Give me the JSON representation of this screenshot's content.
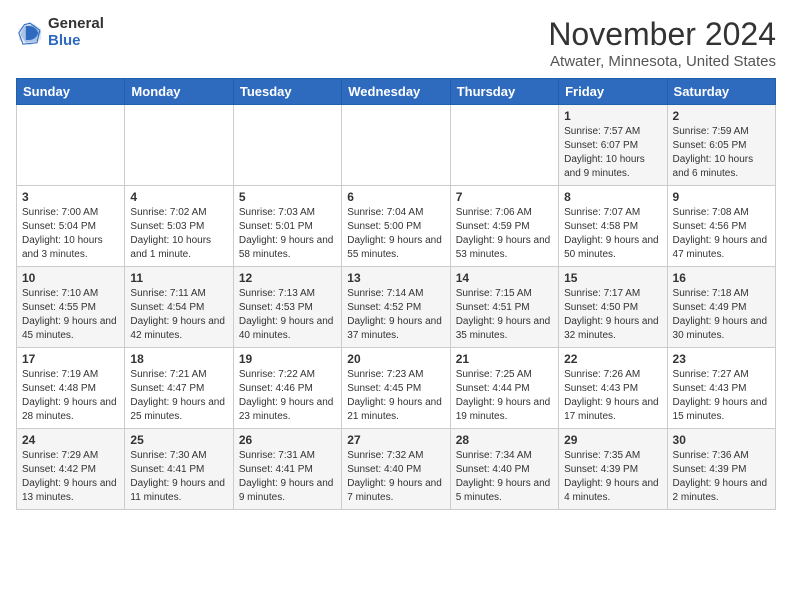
{
  "header": {
    "logo_general": "General",
    "logo_blue": "Blue",
    "month_title": "November 2024",
    "location": "Atwater, Minnesota, United States"
  },
  "days_of_week": [
    "Sunday",
    "Monday",
    "Tuesday",
    "Wednesday",
    "Thursday",
    "Friday",
    "Saturday"
  ],
  "weeks": [
    [
      {
        "num": "",
        "info": ""
      },
      {
        "num": "",
        "info": ""
      },
      {
        "num": "",
        "info": ""
      },
      {
        "num": "",
        "info": ""
      },
      {
        "num": "",
        "info": ""
      },
      {
        "num": "1",
        "info": "Sunrise: 7:57 AM\nSunset: 6:07 PM\nDaylight: 10 hours and 9 minutes."
      },
      {
        "num": "2",
        "info": "Sunrise: 7:59 AM\nSunset: 6:05 PM\nDaylight: 10 hours and 6 minutes."
      }
    ],
    [
      {
        "num": "3",
        "info": "Sunrise: 7:00 AM\nSunset: 5:04 PM\nDaylight: 10 hours and 3 minutes."
      },
      {
        "num": "4",
        "info": "Sunrise: 7:02 AM\nSunset: 5:03 PM\nDaylight: 10 hours and 1 minute."
      },
      {
        "num": "5",
        "info": "Sunrise: 7:03 AM\nSunset: 5:01 PM\nDaylight: 9 hours and 58 minutes."
      },
      {
        "num": "6",
        "info": "Sunrise: 7:04 AM\nSunset: 5:00 PM\nDaylight: 9 hours and 55 minutes."
      },
      {
        "num": "7",
        "info": "Sunrise: 7:06 AM\nSunset: 4:59 PM\nDaylight: 9 hours and 53 minutes."
      },
      {
        "num": "8",
        "info": "Sunrise: 7:07 AM\nSunset: 4:58 PM\nDaylight: 9 hours and 50 minutes."
      },
      {
        "num": "9",
        "info": "Sunrise: 7:08 AM\nSunset: 4:56 PM\nDaylight: 9 hours and 47 minutes."
      }
    ],
    [
      {
        "num": "10",
        "info": "Sunrise: 7:10 AM\nSunset: 4:55 PM\nDaylight: 9 hours and 45 minutes."
      },
      {
        "num": "11",
        "info": "Sunrise: 7:11 AM\nSunset: 4:54 PM\nDaylight: 9 hours and 42 minutes."
      },
      {
        "num": "12",
        "info": "Sunrise: 7:13 AM\nSunset: 4:53 PM\nDaylight: 9 hours and 40 minutes."
      },
      {
        "num": "13",
        "info": "Sunrise: 7:14 AM\nSunset: 4:52 PM\nDaylight: 9 hours and 37 minutes."
      },
      {
        "num": "14",
        "info": "Sunrise: 7:15 AM\nSunset: 4:51 PM\nDaylight: 9 hours and 35 minutes."
      },
      {
        "num": "15",
        "info": "Sunrise: 7:17 AM\nSunset: 4:50 PM\nDaylight: 9 hours and 32 minutes."
      },
      {
        "num": "16",
        "info": "Sunrise: 7:18 AM\nSunset: 4:49 PM\nDaylight: 9 hours and 30 minutes."
      }
    ],
    [
      {
        "num": "17",
        "info": "Sunrise: 7:19 AM\nSunset: 4:48 PM\nDaylight: 9 hours and 28 minutes."
      },
      {
        "num": "18",
        "info": "Sunrise: 7:21 AM\nSunset: 4:47 PM\nDaylight: 9 hours and 25 minutes."
      },
      {
        "num": "19",
        "info": "Sunrise: 7:22 AM\nSunset: 4:46 PM\nDaylight: 9 hours and 23 minutes."
      },
      {
        "num": "20",
        "info": "Sunrise: 7:23 AM\nSunset: 4:45 PM\nDaylight: 9 hours and 21 minutes."
      },
      {
        "num": "21",
        "info": "Sunrise: 7:25 AM\nSunset: 4:44 PM\nDaylight: 9 hours and 19 minutes."
      },
      {
        "num": "22",
        "info": "Sunrise: 7:26 AM\nSunset: 4:43 PM\nDaylight: 9 hours and 17 minutes."
      },
      {
        "num": "23",
        "info": "Sunrise: 7:27 AM\nSunset: 4:43 PM\nDaylight: 9 hours and 15 minutes."
      }
    ],
    [
      {
        "num": "24",
        "info": "Sunrise: 7:29 AM\nSunset: 4:42 PM\nDaylight: 9 hours and 13 minutes."
      },
      {
        "num": "25",
        "info": "Sunrise: 7:30 AM\nSunset: 4:41 PM\nDaylight: 9 hours and 11 minutes."
      },
      {
        "num": "26",
        "info": "Sunrise: 7:31 AM\nSunset: 4:41 PM\nDaylight: 9 hours and 9 minutes."
      },
      {
        "num": "27",
        "info": "Sunrise: 7:32 AM\nSunset: 4:40 PM\nDaylight: 9 hours and 7 minutes."
      },
      {
        "num": "28",
        "info": "Sunrise: 7:34 AM\nSunset: 4:40 PM\nDaylight: 9 hours and 5 minutes."
      },
      {
        "num": "29",
        "info": "Sunrise: 7:35 AM\nSunset: 4:39 PM\nDaylight: 9 hours and 4 minutes."
      },
      {
        "num": "30",
        "info": "Sunrise: 7:36 AM\nSunset: 4:39 PM\nDaylight: 9 hours and 2 minutes."
      }
    ]
  ]
}
